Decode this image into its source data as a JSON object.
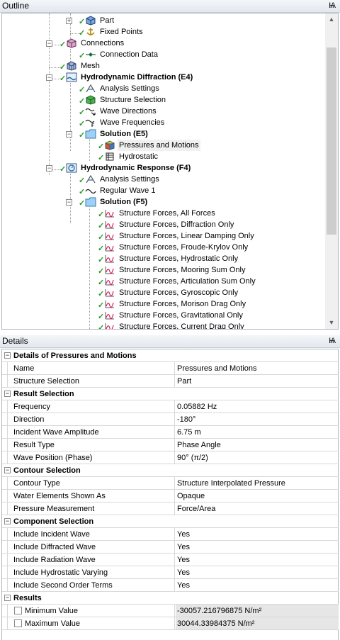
{
  "outline": {
    "title": "Outline",
    "pin": "Ѩ",
    "items": [
      {
        "label": "Part"
      },
      {
        "label": "Fixed Points"
      },
      {
        "label": "Connections"
      },
      {
        "label": "Connection Data"
      },
      {
        "label": "Mesh"
      },
      {
        "label": "Hydrodynamic Diffraction (E4)"
      },
      {
        "label": "Analysis Settings"
      },
      {
        "label": "Structure Selection"
      },
      {
        "label": "Wave Directions"
      },
      {
        "label": "Wave Frequencies"
      },
      {
        "label": "Solution (E5)"
      },
      {
        "label": "Pressures and Motions"
      },
      {
        "label": "Hydrostatic"
      },
      {
        "label": "Hydrodynamic Response (F4)"
      },
      {
        "label": "Analysis Settings"
      },
      {
        "label": "Regular Wave 1"
      },
      {
        "label": "Solution (F5)"
      },
      {
        "label": "Structure Forces, All Forces"
      },
      {
        "label": "Structure Forces, Diffraction Only"
      },
      {
        "label": "Structure Forces, Linear Damping Only"
      },
      {
        "label": "Structure Forces, Froude-Krylov Only"
      },
      {
        "label": "Structure Forces, Hydrostatic Only"
      },
      {
        "label": "Structure Forces, Mooring Sum Only"
      },
      {
        "label": "Structure Forces, Articulation Sum Only"
      },
      {
        "label": "Structure Forces, Gyroscopic Only"
      },
      {
        "label": "Structure Forces, Morison Drag Only"
      },
      {
        "label": "Structure Forces, Gravitational Only"
      },
      {
        "label": "Structure Forces, Current Drag Only"
      }
    ]
  },
  "details": {
    "title": "Details",
    "pin": "Ѩ",
    "groups": [
      {
        "title": "Details of Pressures and Motions",
        "rows": [
          {
            "name": "Name",
            "value": "Pressures and Motions"
          },
          {
            "name": "Structure Selection",
            "value": "Part"
          }
        ]
      },
      {
        "title": "Result Selection",
        "rows": [
          {
            "name": "Frequency",
            "value": "0.05882 Hz"
          },
          {
            "name": "Direction",
            "value": "-180°"
          },
          {
            "name": "Incident Wave Amplitude",
            "value": "6.75 m"
          },
          {
            "name": "Result Type",
            "value": "Phase Angle"
          },
          {
            "name": "Wave Position (Phase)",
            "value": "90° (π/2)"
          }
        ]
      },
      {
        "title": "Contour Selection",
        "rows": [
          {
            "name": "Contour Type",
            "value": "Structure Interpolated Pressure"
          },
          {
            "name": "Water Elements Shown As",
            "value": "Opaque"
          },
          {
            "name": "Pressure Measurement",
            "value": "Force/Area"
          }
        ]
      },
      {
        "title": "Component Selection",
        "rows": [
          {
            "name": "Include Incident Wave",
            "value": "Yes"
          },
          {
            "name": "Include Diffracted Wave",
            "value": "Yes"
          },
          {
            "name": "Include Radiation Wave",
            "value": "Yes"
          },
          {
            "name": "Include Hydrostatic Varying",
            "value": "Yes"
          },
          {
            "name": "Include Second Order Terms",
            "value": "Yes"
          }
        ]
      },
      {
        "title": "Results",
        "rows": [
          {
            "name": "Minimum Value",
            "value": "-30057.216796875 N/m²"
          },
          {
            "name": "Maximum Value",
            "value": "30044.33984375 N/m²"
          }
        ]
      }
    ]
  },
  "colors": {
    "check": "#2a9a2a",
    "folder": "#9fd0f5",
    "selection": "#f0f0f0"
  }
}
